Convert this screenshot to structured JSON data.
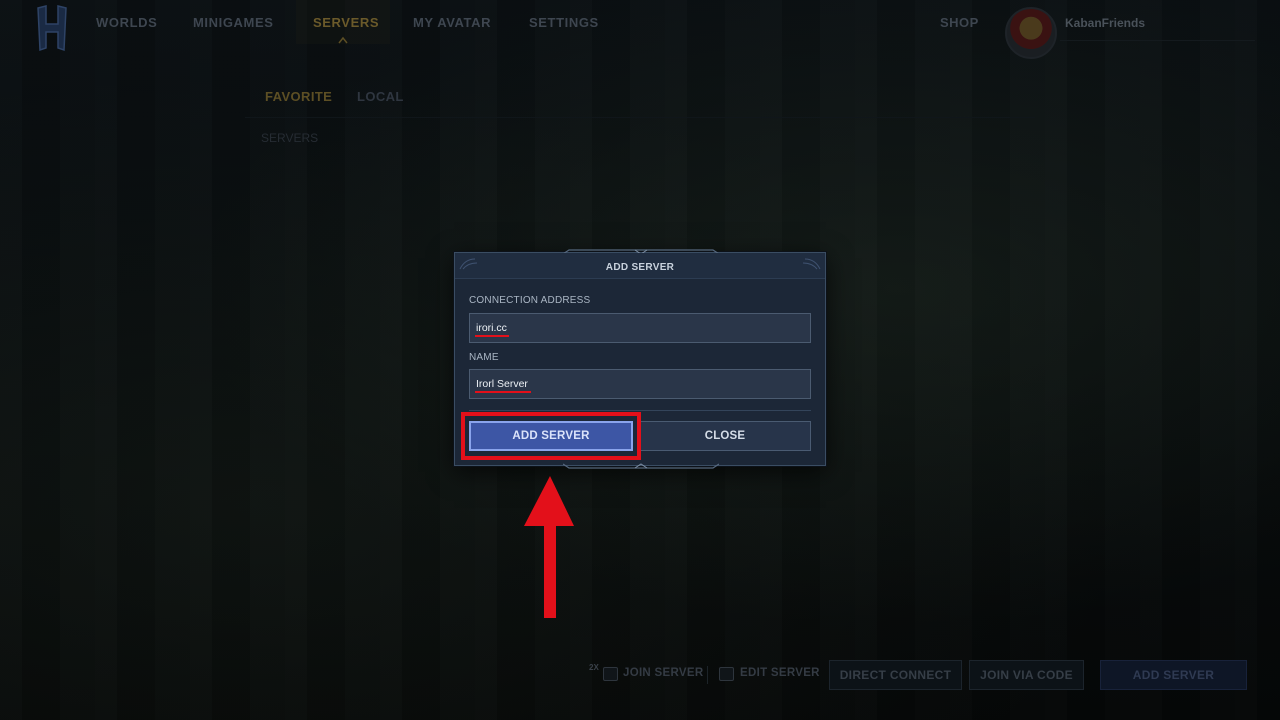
{
  "nav": {
    "items": [
      "WORLDS",
      "MINIGAMES",
      "SERVERS",
      "MY AVATAR",
      "SETTINGS"
    ],
    "active": "SERVERS",
    "shop": "SHOP",
    "username": "KabanFriends"
  },
  "subtabs": {
    "items": [
      "FAVORITE",
      "LOCAL"
    ],
    "active": "FAVORITE",
    "section_label": "SERVERS"
  },
  "dialog": {
    "title": "ADD SERVER",
    "connection_label": "CONNECTION ADDRESS",
    "connection_value": "irori.cc",
    "name_label": "NAME",
    "name_value": "Irorl Server",
    "add_button": "ADD SERVER",
    "close_button": "CLOSE"
  },
  "bottom_bar": {
    "join_shortcut": "2X",
    "join_server": "JOIN SERVER",
    "edit_server": "EDIT SERVER",
    "direct_connect": "DIRECT CONNECT",
    "join_via_code": "JOIN VIA CODE",
    "add_server": "ADD SERVER"
  },
  "colors": {
    "accent_gold": "#6b5a2a",
    "dialog_bg": "#1c2737",
    "primary_button": "#3d56a5",
    "annotation_red": "#e3101a"
  }
}
